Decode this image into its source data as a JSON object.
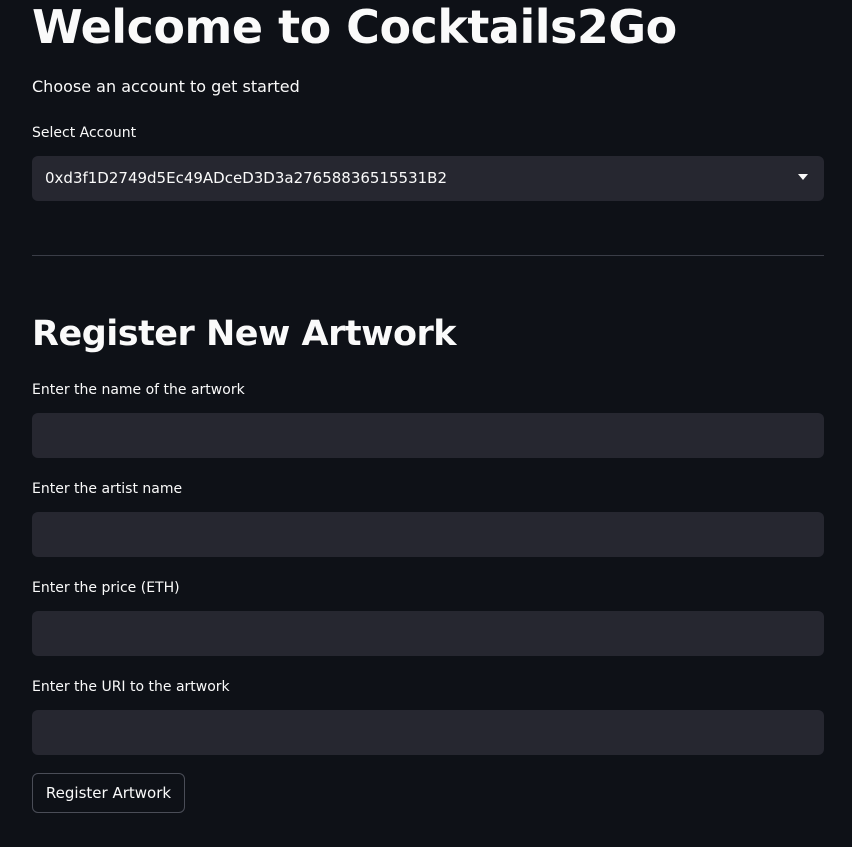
{
  "header": {
    "title": "Welcome to Cocktails2Go",
    "subtitle": "Choose an account to get started"
  },
  "account": {
    "label": "Select Account",
    "selected_value": "0xd3f1D2749d5Ec49ADceD3D3a27658836515531B2"
  },
  "register": {
    "title": "Register New Artwork",
    "fields": [
      {
        "label": "Enter the name of the artwork",
        "value": ""
      },
      {
        "label": "Enter the artist name",
        "value": ""
      },
      {
        "label": "Enter the price (ETH)",
        "value": ""
      },
      {
        "label": "Enter the URI to the artwork",
        "value": ""
      }
    ],
    "button_label": "Register Artwork"
  },
  "colors": {
    "background": "#0e1117",
    "input_background": "#262730",
    "text": "#fafafa",
    "divider": "#3a3d47"
  }
}
